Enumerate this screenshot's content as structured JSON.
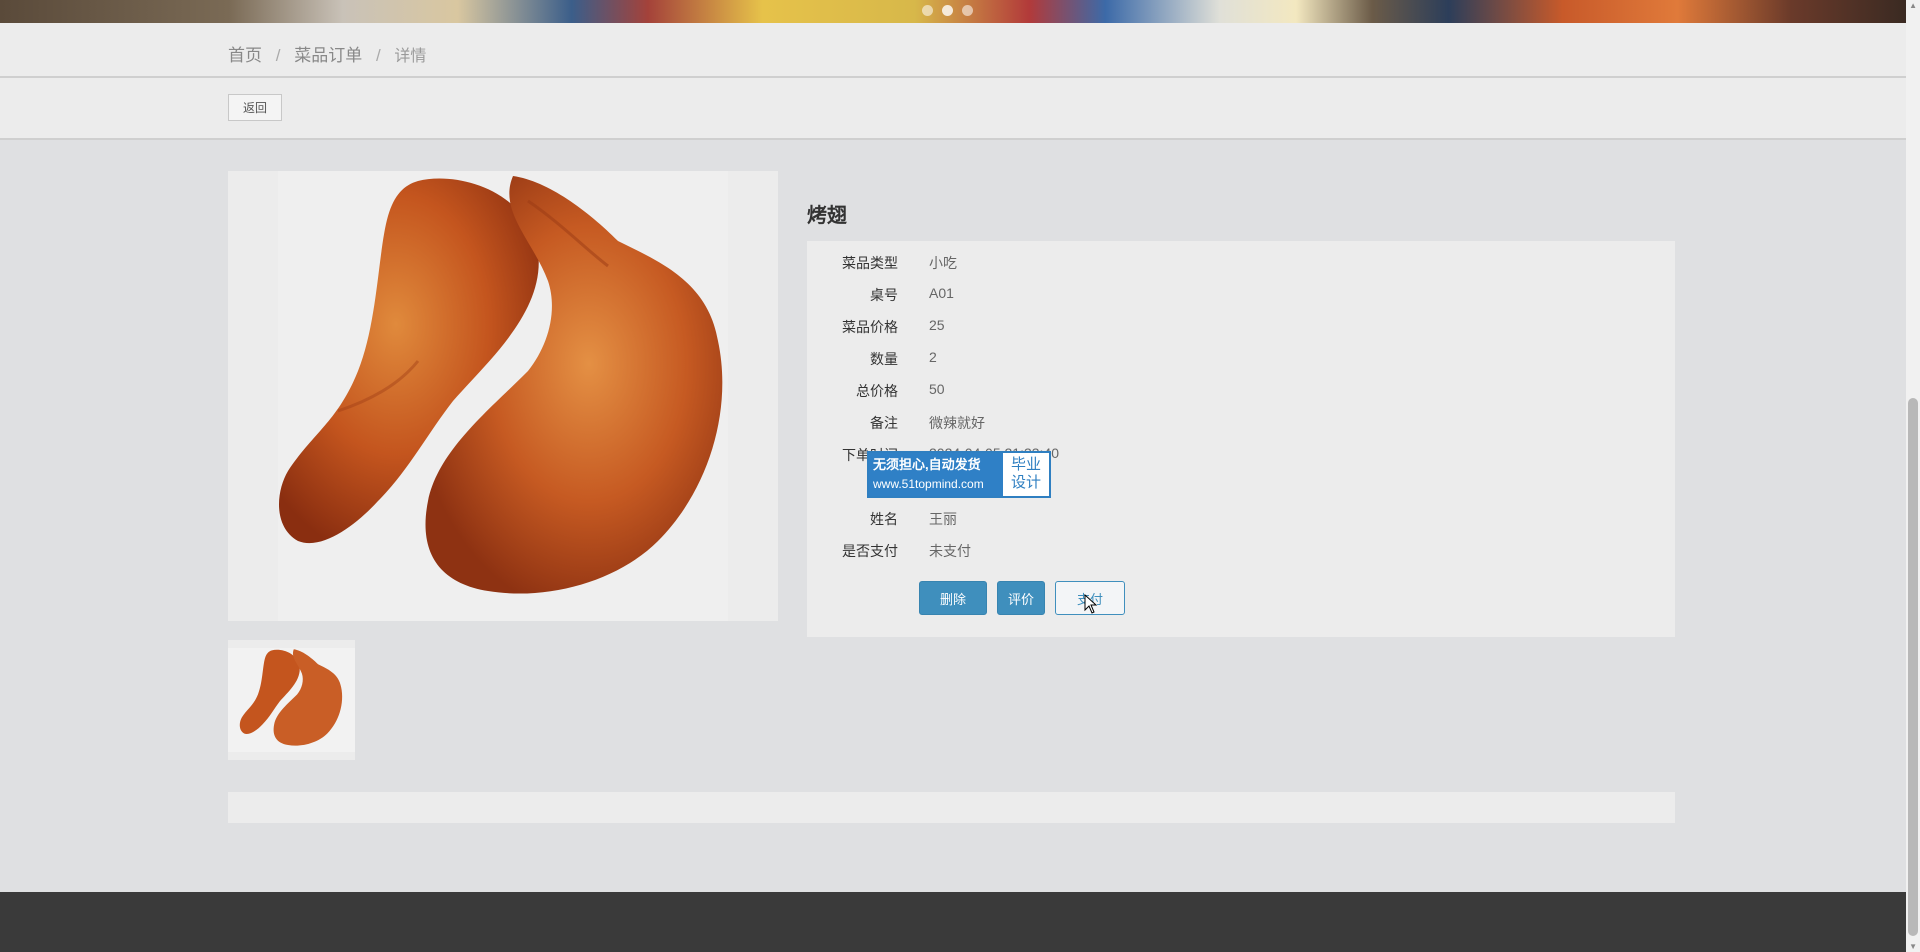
{
  "breadcrumb": {
    "home": "首页",
    "orders": "菜品订单",
    "current": "详情",
    "separator": "/"
  },
  "toolbar": {
    "back_label": "返回"
  },
  "dish": {
    "name": "烤翅",
    "fields": [
      {
        "label": "菜品类型",
        "value": "小吃"
      },
      {
        "label": "桌号",
        "value": "A01"
      },
      {
        "label": "菜品价格",
        "value": "25"
      },
      {
        "label": "数量",
        "value": "2"
      },
      {
        "label": "总价格",
        "value": "50"
      },
      {
        "label": "备注",
        "value": "微辣就好"
      },
      {
        "label": "下单时间",
        "value": "2024-04-05 21:33:40"
      },
      {
        "label": "",
        "value": ""
      },
      {
        "label": "姓名",
        "value": "王丽"
      },
      {
        "label": "是否支付",
        "value": "未支付"
      }
    ]
  },
  "actions": {
    "delete_label": "删除",
    "review_label": "评价",
    "pay_label": "支付"
  },
  "watermark": {
    "line1": "无须担心,自动发货",
    "url": "www.51topmind.com",
    "badge_line1": "毕业",
    "badge_line2": "设计"
  },
  "colors": {
    "primary": "#3f8fbd",
    "background": "#dfe0e2",
    "panel": "#ececec",
    "footer": "#3a3a3a"
  }
}
